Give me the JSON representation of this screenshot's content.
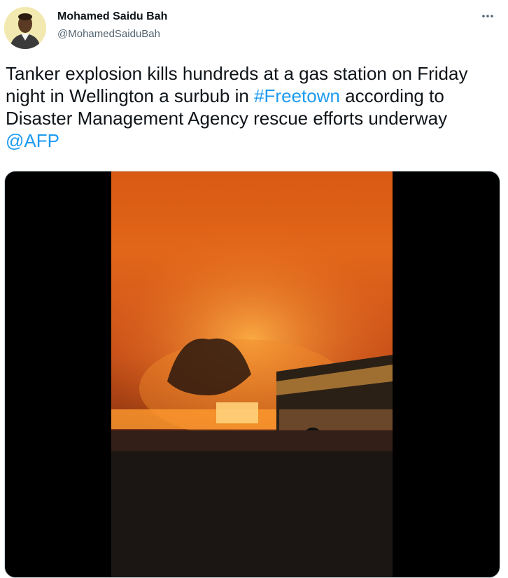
{
  "author": {
    "name": "Mohamed Saidu Bah",
    "handle": "@MohamedSaiduBah",
    "avatar_icon": "profile-photo"
  },
  "more_icon": "ellipsis-icon",
  "tweet": {
    "text_part1": "Tanker explosion kills hundreds at a gas station on Friday night in Wellington a surbub in ",
    "hashtag": "#Freetown",
    "text_part2": " according to Disaster Management Agency rescue efforts underway ",
    "mention": "@AFP",
    "link_color": "#1d9bf0"
  },
  "media": {
    "type": "video",
    "icon": "video-thumbnail",
    "description_colors": {
      "fire": "#e2661a",
      "background": "#000000"
    }
  }
}
